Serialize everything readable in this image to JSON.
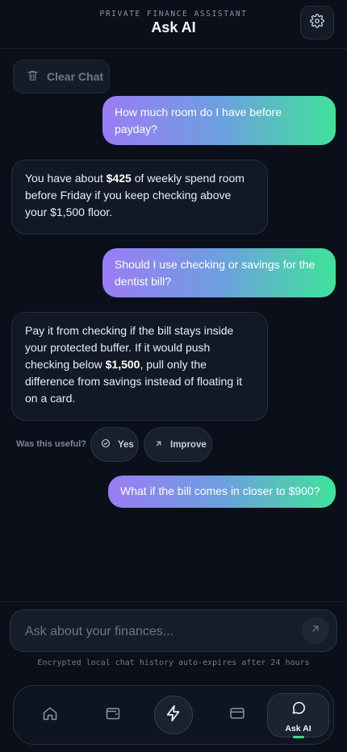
{
  "header": {
    "eyebrow": "PRIVATE FINANCE ASSISTANT",
    "title": "Ask AI"
  },
  "actions": {
    "clear_chat": "Clear Chat"
  },
  "messages": {
    "m1": "How much room do I have before payday?",
    "m2_a": "You have about ",
    "m2_b": "$425",
    "m2_c": " of weekly spend room before Friday if you keep checking above your $1,500 floor.",
    "m3": "Should I use checking or savings for the dentist bill?",
    "m4_a": "Pay it from checking if the bill stays inside your protected buffer. If it would push checking below ",
    "m4_b": "$1,500",
    "m4_c": ", pull only the difference from savings instead of floating it on a card.",
    "m5": "What if the bill comes in closer to $900?"
  },
  "feedback": {
    "label": "Was this useful?",
    "yes": "Yes",
    "improve": "Improve"
  },
  "composer": {
    "placeholder": "Ask about your finances...",
    "value": ""
  },
  "disclaimer": "Encrypted local chat history auto-expires after 24 hours",
  "nav": {
    "items": [
      {
        "icon": "home-icon"
      },
      {
        "icon": "wallet-icon"
      },
      {
        "icon": "lightning-icon"
      },
      {
        "icon": "card-icon"
      },
      {
        "icon": "chat-bubble-icon",
        "label": "Ask AI",
        "active": true
      }
    ]
  },
  "colors": {
    "background": "#0a0f1a",
    "gradient_start": "#9b7cf5",
    "gradient_end": "#3fe39a",
    "accent_green": "#39dd8c"
  }
}
